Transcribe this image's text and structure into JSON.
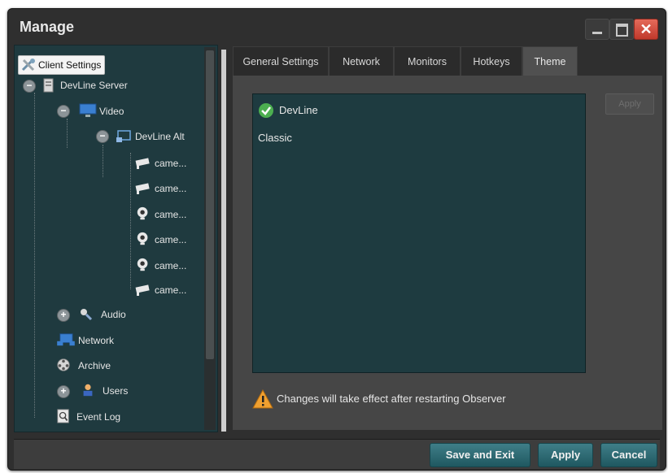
{
  "window": {
    "title": "Manage"
  },
  "tree": {
    "client_settings": "Client Settings",
    "server": "DevLine Server",
    "video": "Video",
    "devline_device": "DevLine Alt",
    "cameras": [
      "came...",
      "came...",
      "came...",
      "came...",
      "came...",
      "came..."
    ],
    "audio": "Audio",
    "network": "Network",
    "archive": "Archive",
    "users": "Users",
    "event_log": "Event Log"
  },
  "tabs": [
    "General Settings",
    "Network",
    "Monitors",
    "Hotkeys",
    "Theme"
  ],
  "active_tab": "Theme",
  "themes": [
    {
      "name": "DevLine",
      "selected": true
    },
    {
      "name": "Classic",
      "selected": false
    }
  ],
  "apply_inner_label": "Apply",
  "warning_text": "Changes will take effect after restarting Observer",
  "buttons": {
    "save_exit": "Save and Exit",
    "apply": "Apply",
    "cancel": "Cancel"
  },
  "colors": {
    "accent": "#2a6b74",
    "panel": "#1f3a3f",
    "close": "#c0392b",
    "check": "#4caf50",
    "warning": "#f0a030"
  }
}
